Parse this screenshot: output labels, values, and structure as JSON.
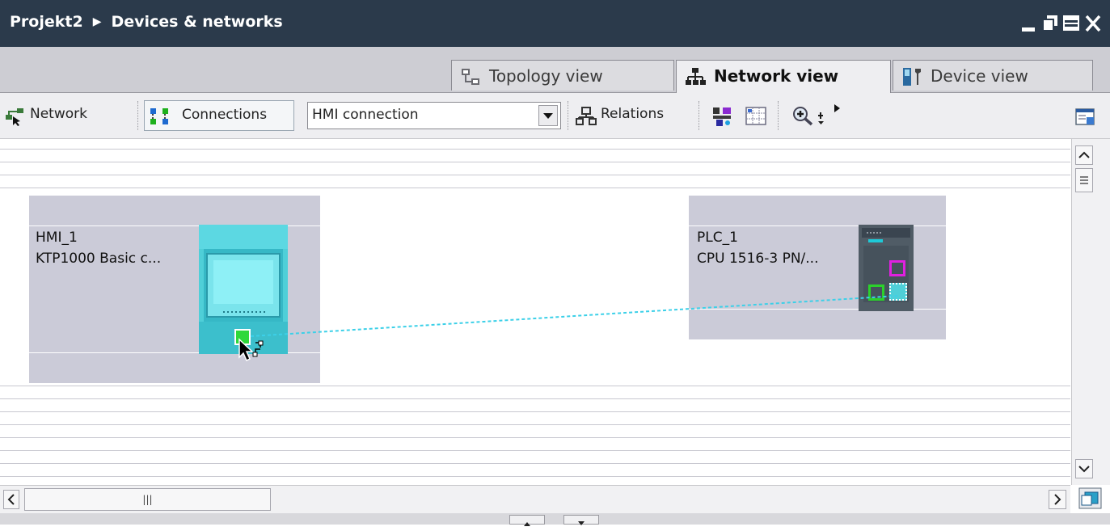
{
  "window": {
    "project": "Projekt2",
    "section": "Devices & networks",
    "controls": [
      "minimize-icon",
      "restore-icon",
      "maximize-icon",
      "close-icon"
    ]
  },
  "tabs": [
    {
      "label": "Topology view",
      "icon": "topology-icon",
      "active": false
    },
    {
      "label": "Network view",
      "icon": "network-icon",
      "active": true
    },
    {
      "label": "Device view",
      "icon": "device-icon",
      "active": false
    }
  ],
  "toolbar": {
    "network_label": "Network",
    "connections_label": "Connections",
    "connection_type": "HMI connection",
    "relations_label": "Relations"
  },
  "devices": [
    {
      "name": "HMI_1",
      "type": "KTP1000 Basic c..."
    },
    {
      "name": "PLC_1",
      "type": "CPU 1516-3 PN/..."
    }
  ],
  "scroll": {
    "hscroll_grip": "|||"
  },
  "colors": {
    "titlebar": "#2b3a4b",
    "hmi": "#4fcfd8",
    "plc": "#4a5560",
    "connection_line": "#3cd0e8",
    "port_green": "#2bd12b",
    "port_magenta": "#e020e0"
  }
}
